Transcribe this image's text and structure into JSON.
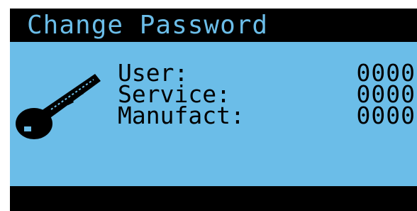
{
  "title": "Change Password",
  "icon": "key-icon",
  "colors": {
    "screen_background": "#6bbde8",
    "foreground": "#000000"
  },
  "rows": [
    {
      "label": "User:",
      "value": "0000"
    },
    {
      "label": "Service:",
      "value": "0000"
    },
    {
      "label": "Manufact:",
      "value": "0000"
    }
  ]
}
